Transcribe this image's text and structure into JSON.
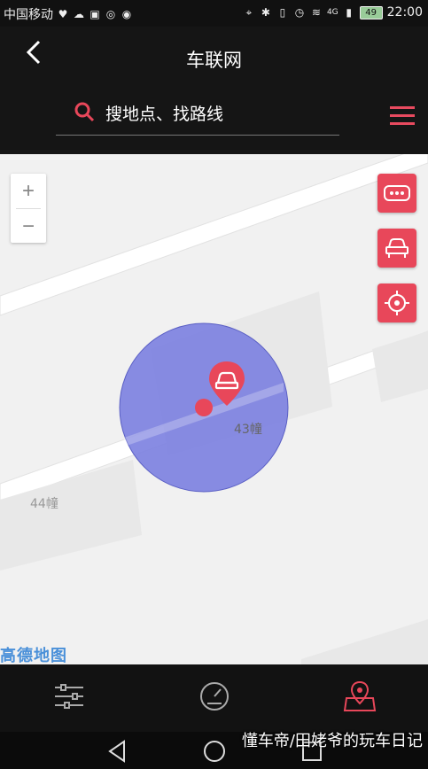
{
  "status_bar": {
    "carrier": "中国移动",
    "network": "4G",
    "battery": "49",
    "time": "22:00"
  },
  "header": {
    "title": "车联网",
    "search_placeholder": "搜地点、找路线"
  },
  "map": {
    "building_label_1": "43幢",
    "building_label_2": "44幢",
    "provider_label": "高德地图",
    "accuracy_color": "#7b7fe0",
    "accent_color": "#e8475a"
  },
  "tabs": [
    {
      "icon": "sliders-icon"
    },
    {
      "icon": "speedometer-icon"
    },
    {
      "icon": "map-pin-icon",
      "active": true
    }
  ],
  "watermark": "懂车帝/田姥爷的玩车日记"
}
